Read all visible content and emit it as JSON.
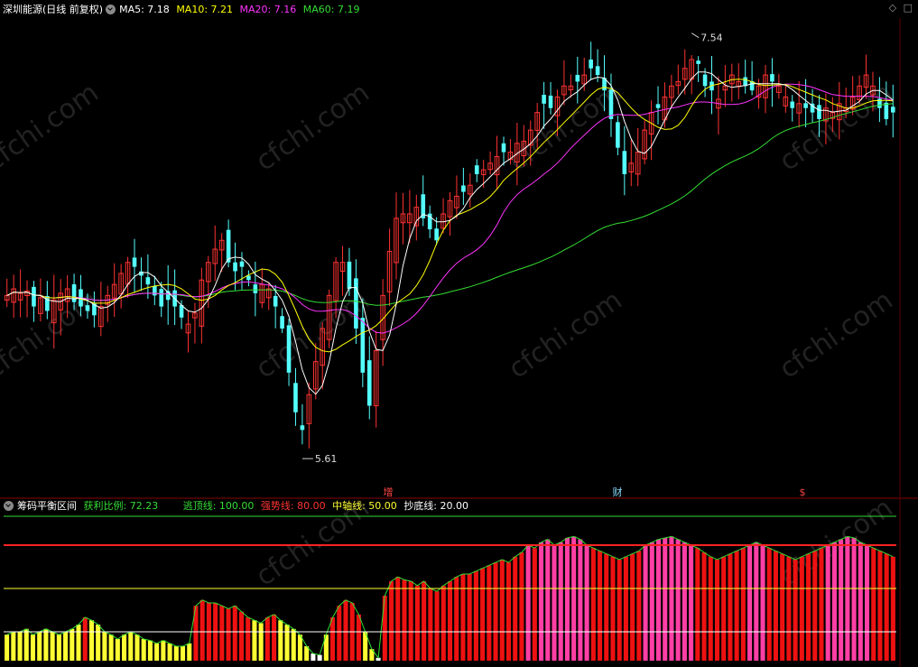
{
  "main_panel": {
    "title": "深圳能源(日线 前复权)",
    "ma_labels": [
      {
        "text": "MA5: 7.18",
        "color": "#ffffff"
      },
      {
        "text": "MA10: 7.21",
        "color": "#ffff00"
      },
      {
        "text": "MA20: 7.16",
        "color": "#ff33ff"
      },
      {
        "text": "MA60: 7.19",
        "color": "#33dd33"
      }
    ],
    "corner_icons": "◇ □",
    "high_label": "7.54",
    "low_label": "5.61",
    "event_markers": [
      {
        "text": "增",
        "color": "#ff4444"
      },
      {
        "text": "财",
        "color": "#88ddff"
      },
      {
        "text": "$",
        "color": "#ff4444"
      }
    ],
    "watermark": "cfchi.com"
  },
  "sub_panel": {
    "title": "筹码平衡区间",
    "labels": [
      {
        "text": "获利比例: 72.23",
        "color": "#33dd33"
      },
      {
        "text": "逃顶线: 100.00",
        "color": "#33dd33"
      },
      {
        "text": "强势线: 80.00",
        "color": "#ff3333"
      },
      {
        "text": "中轴线: 50.00",
        "color": "#ffff33"
      },
      {
        "text": "抄底线: 20.00",
        "color": "#ffffff"
      }
    ]
  },
  "chart_data": {
    "type": "candlestick",
    "price_range": [
      5.5,
      7.6
    ],
    "high_mark": 7.54,
    "low_mark": 5.61,
    "closes": [
      6.35,
      6.38,
      6.36,
      6.37,
      6.3,
      6.34,
      6.28,
      6.33,
      6.36,
      6.38,
      6.32,
      6.3,
      6.28,
      6.26,
      6.3,
      6.35,
      6.4,
      6.45,
      6.5,
      6.48,
      6.44,
      6.4,
      6.35,
      6.3,
      6.33,
      6.3,
      6.25,
      6.22,
      6.27,
      6.42,
      6.5,
      6.56,
      6.6,
      6.5,
      6.46,
      6.48,
      6.42,
      6.36,
      6.4,
      6.38,
      6.3,
      6.2,
      6.0,
      5.82,
      5.74,
      5.9,
      6.05,
      6.2,
      6.35,
      6.5,
      6.5,
      6.38,
      6.2,
      6.0,
      5.85,
      6.1,
      6.35,
      6.55,
      6.7,
      6.72,
      6.72,
      6.75,
      6.7,
      6.65,
      6.6,
      6.72,
      6.78,
      6.8,
      6.82,
      6.85,
      6.9,
      6.92,
      6.95,
      6.98,
      7.0,
      7.0,
      7.04,
      7.05,
      7.1,
      7.18,
      7.22,
      7.2,
      7.25,
      7.3,
      7.3,
      7.32,
      7.35,
      7.38,
      7.35,
      7.28,
      7.15,
      7.02,
      6.9,
      6.95,
      7.0,
      7.1,
      7.18,
      7.2,
      7.25,
      7.3,
      7.32,
      7.38,
      7.42,
      7.4,
      7.3,
      7.28,
      7.24,
      7.3,
      7.35,
      7.32,
      7.3,
      7.28,
      7.3,
      7.35,
      7.32,
      7.3,
      7.25,
      7.2,
      7.22,
      7.2,
      7.18,
      7.15,
      7.2,
      7.18,
      7.22,
      7.2,
      7.25,
      7.3,
      7.35,
      7.3,
      7.2,
      7.15,
      7.18
    ],
    "ma_values_last": {
      "MA5": 7.18,
      "MA10": 7.21,
      "MA20": 7.16,
      "MA60": 7.19
    },
    "profit_ratio": [
      18,
      20,
      20,
      22,
      18,
      20,
      22,
      20,
      18,
      20,
      22,
      25,
      30,
      28,
      25,
      20,
      18,
      15,
      18,
      20,
      18,
      15,
      14,
      12,
      14,
      12,
      10,
      10,
      12,
      38,
      42,
      40,
      40,
      38,
      36,
      38,
      34,
      30,
      28,
      26,
      30,
      32,
      28,
      25,
      22,
      18,
      10,
      5,
      4,
      18,
      30,
      38,
      42,
      40,
      32,
      20,
      8,
      2,
      45,
      55,
      58,
      56,
      55,
      52,
      55,
      50,
      48,
      52,
      55,
      58,
      60,
      60,
      62,
      64,
      66,
      68,
      70,
      68,
      72,
      75,
      80,
      78,
      82,
      84,
      80,
      82,
      85,
      86,
      84,
      80,
      78,
      76,
      74,
      72,
      70,
      72,
      74,
      76,
      80,
      82,
      84,
      85,
      86,
      84,
      82,
      80,
      78,
      75,
      72,
      70,
      72,
      74,
      76,
      78,
      80,
      82,
      80,
      78,
      76,
      74,
      72,
      70,
      72,
      74,
      76,
      78,
      80,
      82,
      84,
      86,
      85,
      82,
      80,
      78,
      76,
      74,
      72
    ]
  }
}
